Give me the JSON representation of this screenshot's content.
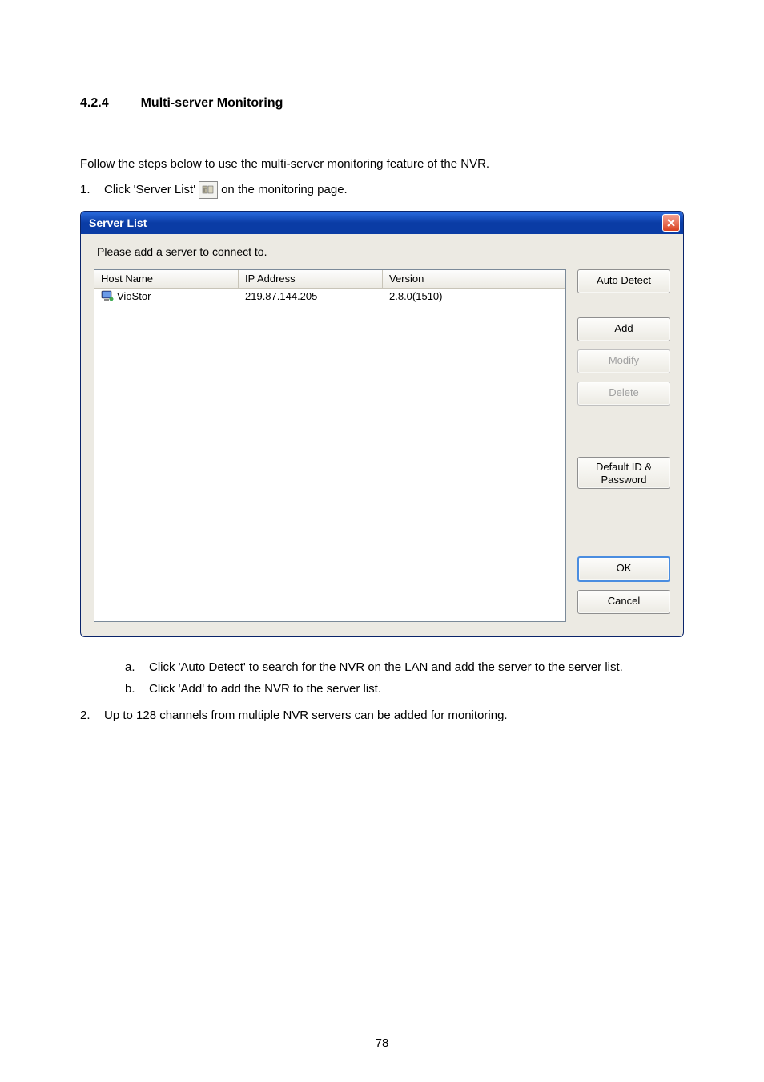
{
  "heading": {
    "number": "4.2.4",
    "title": "Multi-server Monitoring"
  },
  "intro": "Follow the steps below to use the multi-server monitoring feature of the NVR.",
  "step1": {
    "number": "1.",
    "before": "Click 'Server List'",
    "after": "on the monitoring page.",
    "icon_name": "server-list-icon"
  },
  "dialog": {
    "title": "Server List",
    "prompt": "Please add a server to connect to.",
    "columns": {
      "hostname": "Host Name",
      "ip": "IP Address",
      "version": "Version"
    },
    "rows": [
      {
        "hostname": "VioStor",
        "ip": "219.87.144.205",
        "version": "2.8.0(1510)"
      }
    ],
    "buttons": {
      "auto_detect": "Auto Detect",
      "add": "Add",
      "modify": "Modify",
      "delete": "Delete",
      "default_id": "Default ID & Password",
      "ok": "OK",
      "cancel": "Cancel"
    }
  },
  "subitems": {
    "a": {
      "label": "a.",
      "text": "Click 'Auto Detect' to search for the NVR on the LAN and add the server to the server list."
    },
    "b": {
      "label": "b.",
      "text": "Click 'Add' to add the NVR to the server list."
    }
  },
  "step2": {
    "number": "2.",
    "text": "Up to 128 channels from multiple NVR servers can be added for monitoring."
  },
  "page_number": "78"
}
